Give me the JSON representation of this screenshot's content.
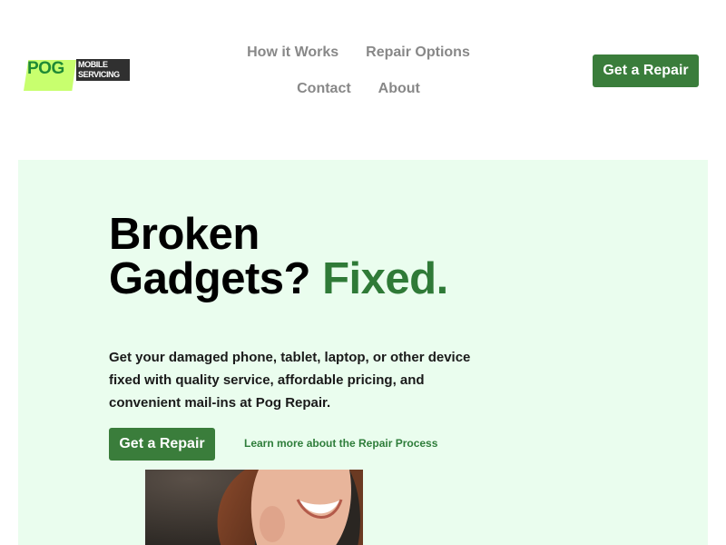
{
  "logo": {
    "brand": "POG",
    "sub_line1": "MOBILE",
    "sub_line2": "SERVICING"
  },
  "nav": {
    "items": [
      {
        "label": "How it Works"
      },
      {
        "label": "Repair Options"
      },
      {
        "label": "Contact"
      },
      {
        "label": "About"
      }
    ]
  },
  "header": {
    "cta_label": "Get a Repair"
  },
  "hero": {
    "title_line1": "Broken",
    "title_line2": "Gadgets?",
    "title_accent": "Fixed.",
    "description": "Get your damaged phone, tablet, laptop, or other device fixed with quality service, affordable pricing, and convenient mail-ins at Pog Repair.",
    "cta_label": "Get a Repair",
    "secondary_link": "Learn more about the Repair Process"
  },
  "colors": {
    "accent_green": "#3a7d3b",
    "hero_background": "#eafdee",
    "logo_lime": "#c8ff6e",
    "nav_text": "#888888"
  }
}
